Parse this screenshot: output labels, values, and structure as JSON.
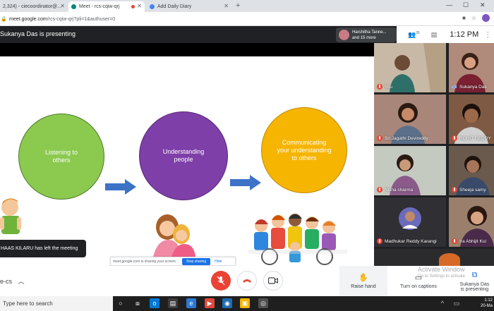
{
  "browser": {
    "tabs": [
      {
        "label": "2,324) - ciecoordinator@...",
        "active": false
      },
      {
        "label": "Meet - rcs-cqiw-qrj",
        "active": true
      },
      {
        "label": "Add Daily Diary",
        "active": false
      }
    ],
    "new_tab_label": "+",
    "window_controls": [
      "—",
      "☐",
      "✕"
    ],
    "url_host": "meet.google.com",
    "url_path": "/rcs-cqiw-qrj?pli=1&authuser=0"
  },
  "meet": {
    "presenting_text": "Sukanya Das is presenting",
    "presenter_chip": {
      "name": "Harshitha Tanne...",
      "more": "and 15 more"
    },
    "participants_count": "26",
    "time": "1:12 PM",
    "toast": "HAAS KILARU has left the meeting",
    "share_bar": {
      "message": "meet.google.com is sharing your screen.",
      "stop": "Stop sharing",
      "hide": "Hide"
    },
    "meeting_code": "e-cs",
    "controls": {
      "raise_hand": "Raise hand",
      "captions": "Turn on captions",
      "presenting_line1": "Sukanya Das",
      "presenting_line2": "is presenting"
    },
    "watermark": {
      "line1": "Activate Window",
      "line2": "Go to Settings to activate"
    }
  },
  "slide": {
    "circle1": "Listening to others",
    "circle2": "Understanding people",
    "circle3": "Communicating your understanding to others",
    "colors": {
      "green": "#8bc94f",
      "purple": "#7e3fa8",
      "yellow": "#f6b500",
      "arrow": "#3d72c6"
    }
  },
  "participants": [
    {
      "name": "You",
      "muted": true,
      "bg": "#b9a58f"
    },
    {
      "name": "Sukanya Das",
      "muted": false,
      "speaking": true,
      "bg": "#a27c74"
    },
    {
      "name": "Sri Jagathi Devireddy",
      "muted": true,
      "bg": "#8f6a55"
    },
    {
      "name": "ROHIT REDDY",
      "muted": true,
      "bg": "#6b4d3c"
    },
    {
      "name": "Nisha sharma",
      "muted": true,
      "bg": "#9aa59c"
    },
    {
      "name": "Sheeja samy",
      "muted": true,
      "bg": "#7a6a5c"
    },
    {
      "name": "Madhukar Reddy Karangi",
      "muted": true,
      "bg": "#3f3f44"
    },
    {
      "name": "Ira Abhijit Kul",
      "muted": true,
      "bg": "#8a6d5a"
    }
  ],
  "taskbar": {
    "search_placeholder": "Type here to search",
    "clock_time": "1:12",
    "clock_date": "20-Ma"
  }
}
